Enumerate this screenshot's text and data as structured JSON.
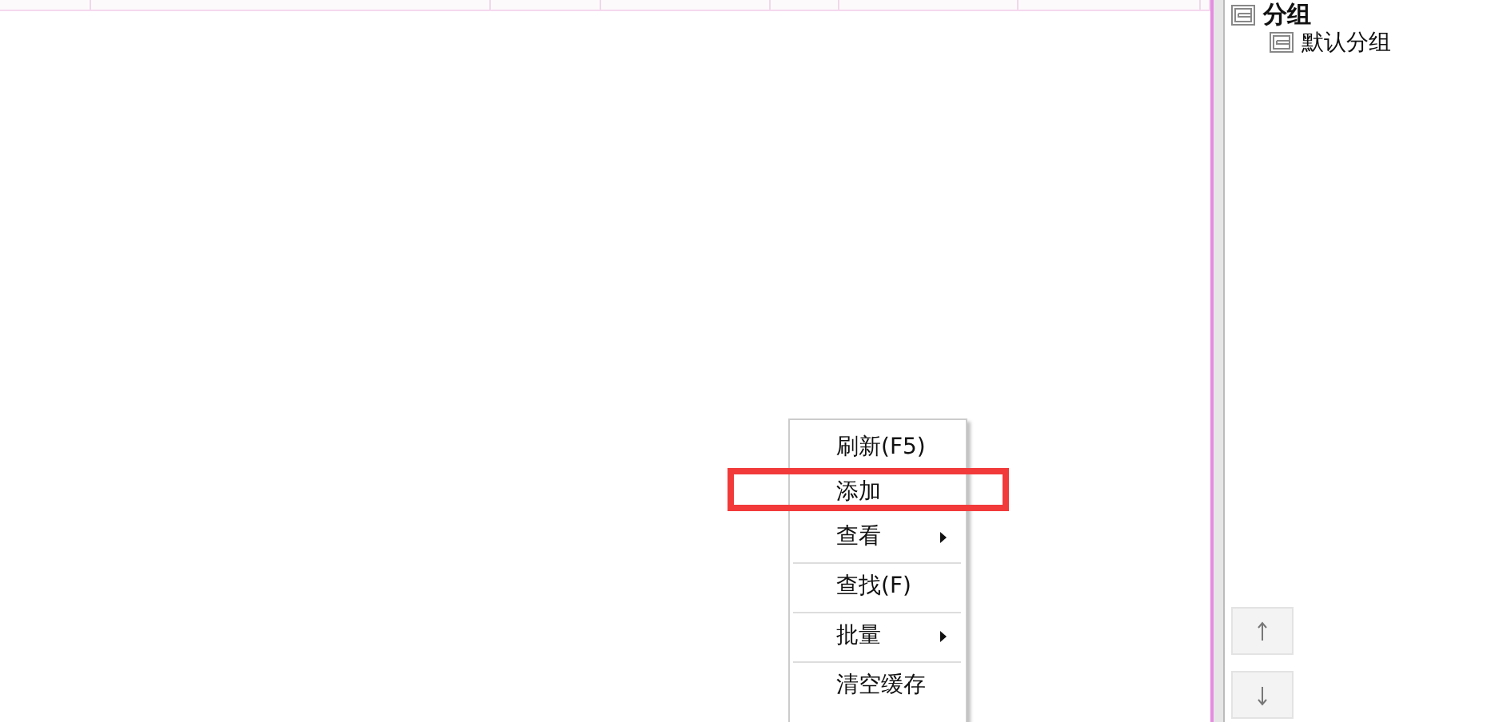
{
  "context_menu": [
    {
      "label": "刷新(F5)",
      "has_submenu": false,
      "separator_before": false,
      "highlighted": false
    },
    {
      "label": "添加",
      "has_submenu": false,
      "separator_before": false,
      "highlighted": true
    },
    {
      "label": "查看",
      "has_submenu": true,
      "separator_before": false,
      "highlighted": false
    },
    {
      "label": "查找(F)",
      "has_submenu": false,
      "separator_before": true,
      "highlighted": false
    },
    {
      "label": "批量",
      "has_submenu": true,
      "separator_before": true,
      "highlighted": false
    },
    {
      "label": "清空缓存",
      "has_submenu": false,
      "separator_before": true,
      "highlighted": false
    }
  ],
  "group_tree": [
    {
      "label": "分组",
      "expanded": true,
      "children": [
        {
          "label": "默认分组",
          "expanded": true
        }
      ]
    }
  ]
}
